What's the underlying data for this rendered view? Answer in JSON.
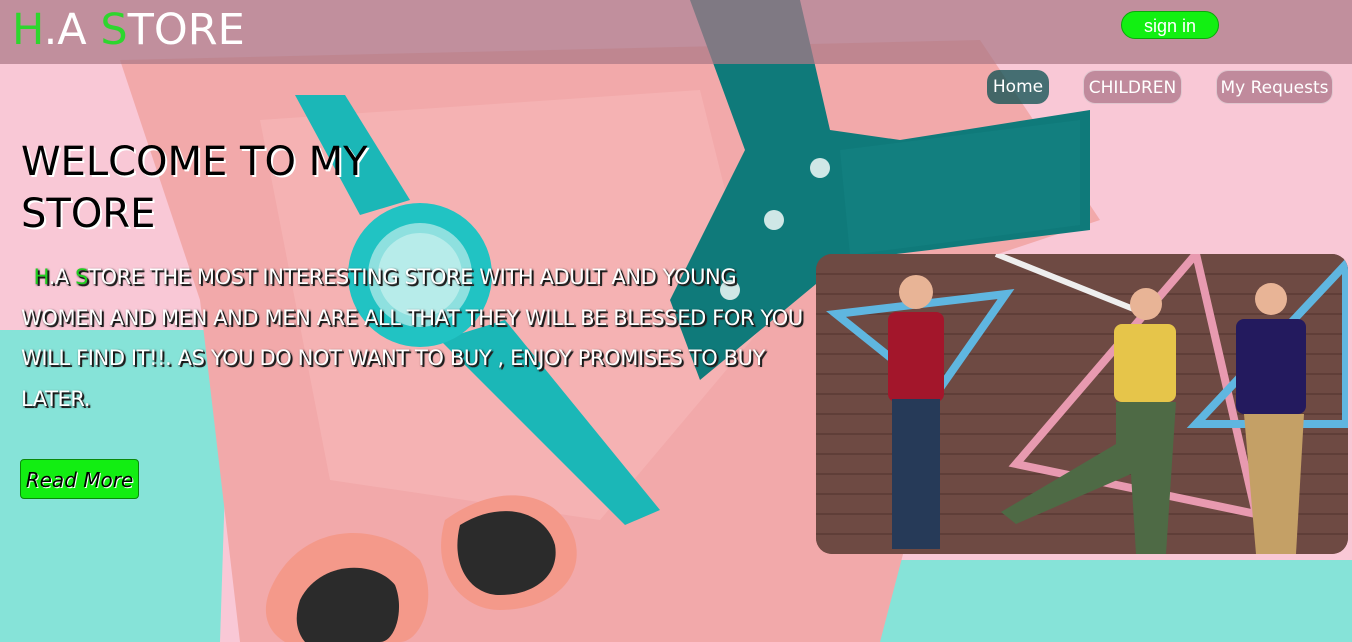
{
  "header": {
    "logo": {
      "h": "H",
      "mid": ".A ",
      "s": "S",
      "rest": "TORE"
    },
    "signin_label": "sign in"
  },
  "nav": {
    "home_label": "Home",
    "children_label": "CHILDREN",
    "requests_label": "My Requests"
  },
  "hero": {
    "welcome_title": "WELCOME TO MY STORE",
    "description": {
      "h": "H",
      "mid": ".A ",
      "s": "S",
      "text": "TORE THE MOST INTERESTING STORE WITH ADULT AND YOUNG WOMEN AND MEN AND MEN ARE ALL THAT THEY WILL BE BLESSED FOR YOU WILL FIND IT!!. AS YOU DO NOT WANT TO BUY , ENJOY PROMISES TO BUY LATER."
    },
    "read_more_label": "Read More"
  },
  "colors": {
    "accent_green": "#12f012",
    "header_bg": "#aa7887",
    "teal": "#0f7a7a",
    "pink_bg": "#f9c8d6",
    "mint_bg": "#86e3d8"
  }
}
